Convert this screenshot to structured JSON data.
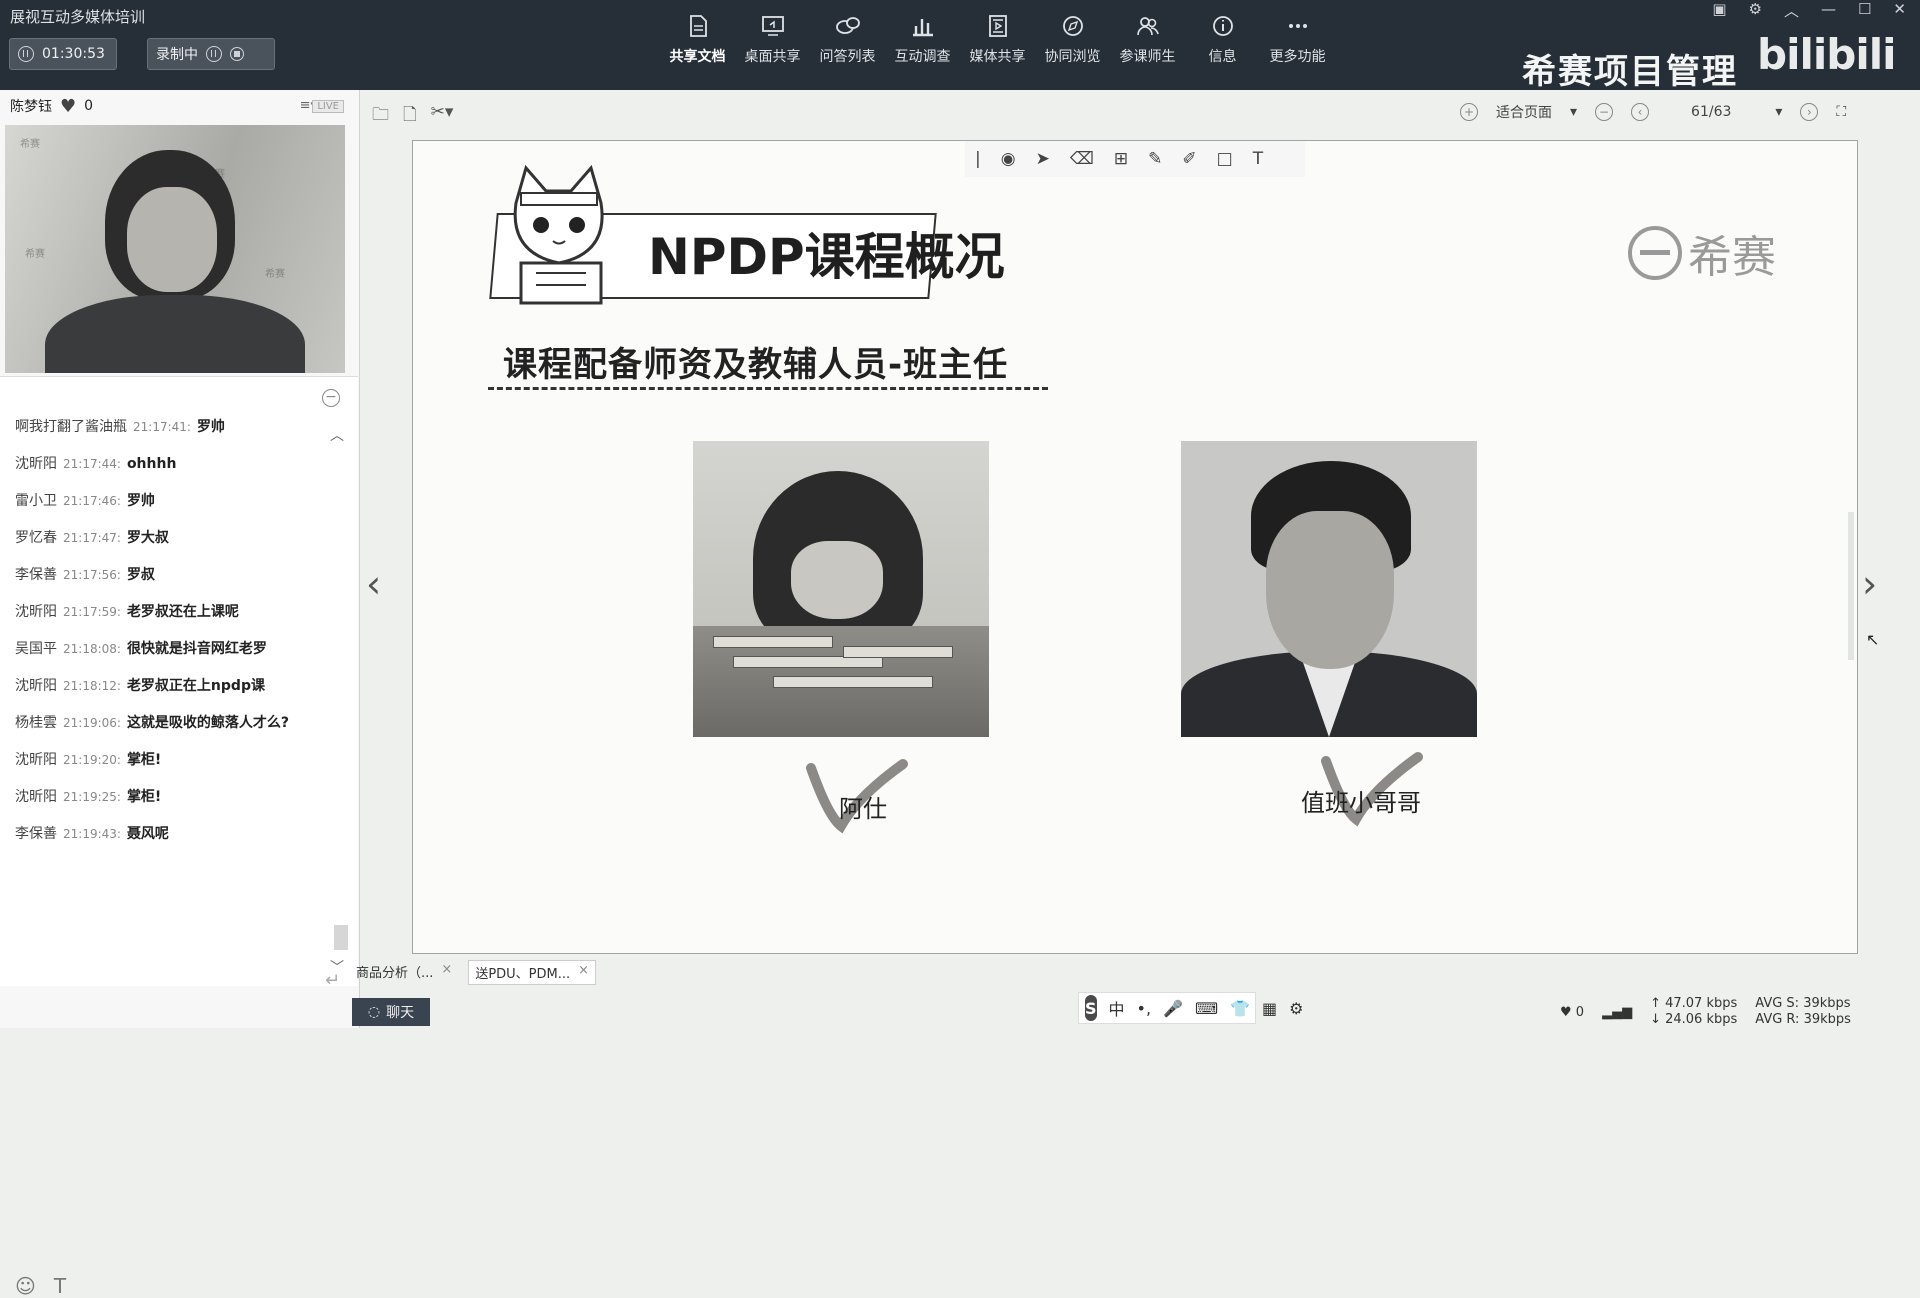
{
  "app": {
    "title": "展视互动多媒体培训"
  },
  "controls": {
    "timer": "01:30:53",
    "record_label": "录制中"
  },
  "toolbar": [
    {
      "label": "共享文档",
      "icon": "document-icon",
      "active": true
    },
    {
      "label": "桌面共享",
      "icon": "desktop-share-icon"
    },
    {
      "label": "问答列表",
      "icon": "qa-icon"
    },
    {
      "label": "互动调查",
      "icon": "survey-icon"
    },
    {
      "label": "媒体共享",
      "icon": "media-icon"
    },
    {
      "label": "协同浏览",
      "icon": "compass-icon"
    },
    {
      "label": "参课师生",
      "icon": "people-icon"
    },
    {
      "label": "信息",
      "icon": "info-icon"
    },
    {
      "label": "更多功能",
      "icon": "more-icon"
    }
  ],
  "brand": {
    "text": "希赛项目管理",
    "bili": "bilibili"
  },
  "user": {
    "name": "陈梦钰",
    "likes": "0",
    "live": "LIVE"
  },
  "chat": {
    "messages": [
      {
        "name": "啊我打翻了酱油瓶",
        "time": "21:17:41:",
        "text": "罗帅"
      },
      {
        "name": "沈昕阳",
        "time": "21:17:44:",
        "text": "ohhhh"
      },
      {
        "name": "雷小卫",
        "time": "21:17:46:",
        "text": "罗帅"
      },
      {
        "name": "罗忆春",
        "time": "21:17:47:",
        "text": "罗大叔"
      },
      {
        "name": "李保善",
        "time": "21:17:56:",
        "text": "罗叔"
      },
      {
        "name": "沈昕阳",
        "time": "21:17:59:",
        "text": "老罗叔还在上课呢"
      },
      {
        "name": "吴国平",
        "time": "21:18:08:",
        "text": "很快就是抖音网红老罗"
      },
      {
        "name": "沈昕阳",
        "time": "21:18:12:",
        "text": "老罗叔正在上npdp课"
      },
      {
        "name": "杨桂雲",
        "time": "21:19:06:",
        "text": "这就是吸收的鲸落人才么?"
      },
      {
        "name": "沈昕阳",
        "time": "21:19:20:",
        "text": "掌柜!"
      },
      {
        "name": "沈昕阳",
        "time": "21:19:25:",
        "text": "掌柜!"
      },
      {
        "name": "李保善",
        "time": "21:19:43:",
        "text": "聂风呢"
      }
    ],
    "chat_button": "聊天"
  },
  "doc": {
    "zoom": "适合页面",
    "page": "61/63"
  },
  "slide": {
    "title": "NPDP课程概况",
    "logo_text": "希赛",
    "subtitle": "课程配备师资及教辅人员-班主任",
    "person1": "阿仕",
    "person2": "值班小哥哥"
  },
  "tabs": [
    {
      "label": "商品分析（..."
    },
    {
      "label": "送PDU、PDM..."
    }
  ],
  "status": {
    "likes": "0",
    "up": "47.07 kbps",
    "down": "24.06 kbps",
    "avg_s": "AVG S: 39kbps",
    "avg_r": "AVG R: 39kbps"
  },
  "ime": {
    "mode": "中"
  }
}
